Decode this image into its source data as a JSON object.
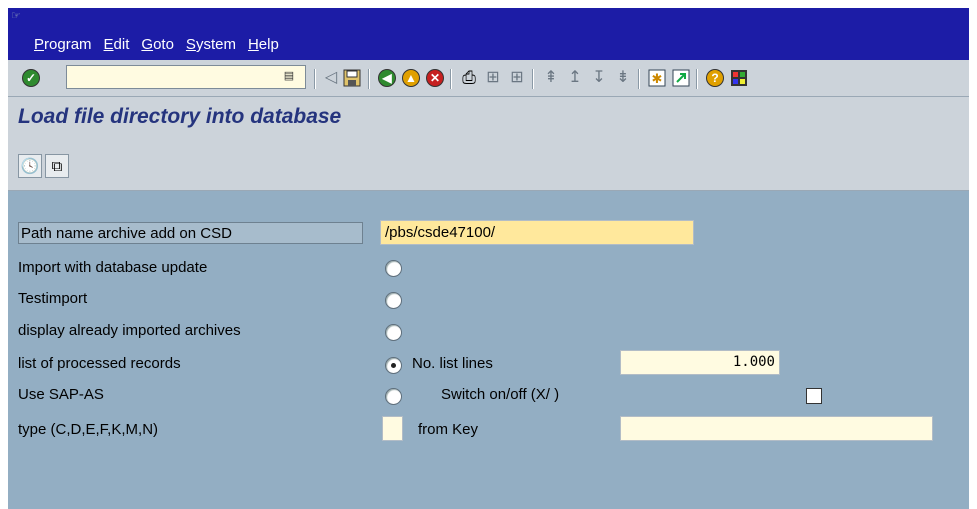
{
  "menu": {
    "items": [
      "Program",
      "Edit",
      "Goto",
      "System",
      "Help"
    ],
    "accel": [
      "P",
      "E",
      "G",
      "S",
      "H"
    ],
    "rest": [
      "rogram",
      "dit",
      "oto",
      "ystem",
      "elp"
    ]
  },
  "toolbar": {
    "command_value": ""
  },
  "page": {
    "title": "Load file directory into database"
  },
  "form": {
    "path_label": "Path name archive add on CSD",
    "path_value": "/pbs/csde47100/",
    "import_db_label": "Import with database update",
    "testimport_label": "Testimport",
    "display_imported_label": "display already imported archives",
    "processed_records_label": "list of processed records",
    "no_list_lines_label": "No. list lines",
    "no_list_lines_value": "1.000",
    "use_sapas_label": "Use SAP-AS",
    "switch_label": "Switch on/off (X/ )",
    "type_label": "type (C,D,E,F,K,M,N)",
    "type_value": "",
    "from_key_label": "from Key",
    "from_key_value": ""
  },
  "colors": {
    "menubar": "#1c1ca6",
    "background": "#93aec3",
    "title": "#25347e",
    "field": "#fffbe1"
  }
}
